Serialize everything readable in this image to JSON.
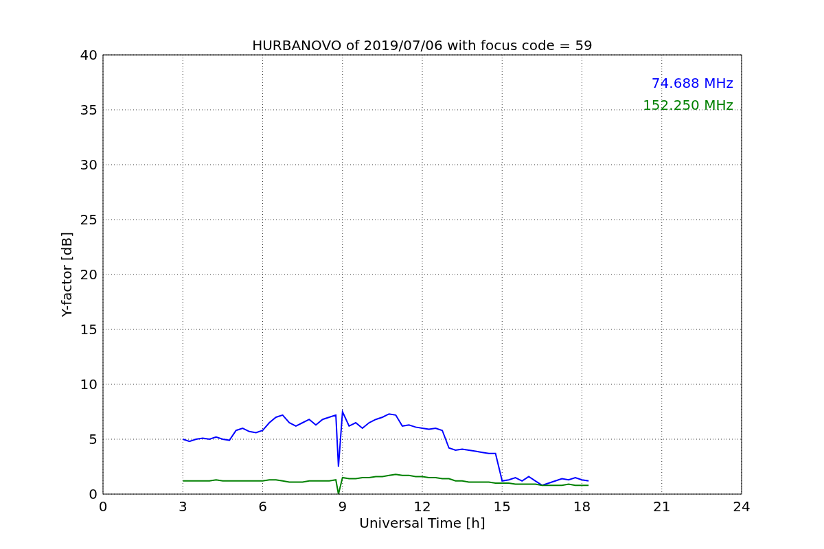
{
  "chart_data": {
    "type": "line",
    "title": "HURBANOVO of 2019/07/06 with focus code = 59",
    "xlabel": "Universal Time [h]",
    "ylabel": "Y-factor [dB]",
    "x": [
      3,
      3.25,
      3.5,
      3.75,
      4,
      4.25,
      4.5,
      4.75,
      5,
      5.25,
      5.5,
      5.75,
      6,
      6.25,
      6.5,
      6.75,
      7,
      7.25,
      7.5,
      7.75,
      8,
      8.25,
      8.5,
      8.75,
      8.85,
      9,
      9.25,
      9.5,
      9.75,
      10,
      10.25,
      10.5,
      10.75,
      11,
      11.25,
      11.5,
      11.75,
      12,
      12.25,
      12.5,
      12.75,
      13,
      13.25,
      13.5,
      13.75,
      14,
      14.25,
      14.5,
      14.75,
      15,
      15.25,
      15.5,
      15.75,
      16,
      16.25,
      16.5,
      16.75,
      17,
      17.25,
      17.5,
      17.75,
      18,
      18.25
    ],
    "series": [
      {
        "name": "74.688 MHz",
        "color": "#0000ff",
        "values": [
          5,
          4.8,
          5,
          5.1,
          5,
          5.2,
          5,
          4.9,
          5.8,
          6,
          5.7,
          5.6,
          5.8,
          6.5,
          7,
          7.2,
          6.5,
          6.2,
          6.5,
          6.8,
          6.3,
          6.8,
          7,
          7.2,
          2.5,
          7.5,
          6.2,
          6.5,
          6,
          6.5,
          6.8,
          7,
          7.3,
          7.2,
          6.2,
          6.3,
          6.1,
          6,
          5.9,
          6,
          5.8,
          4.2,
          4,
          4.1,
          4,
          3.9,
          3.8,
          3.7,
          3.7,
          1.2,
          1.3,
          1.5,
          1.2,
          1.6,
          1.2,
          0.8,
          1,
          1.2,
          1.4,
          1.3,
          1.5,
          1.3,
          1.2
        ]
      },
      {
        "name": "152.250 MHz",
        "color": "#008000",
        "values": [
          1.2,
          1.2,
          1.2,
          1.2,
          1.2,
          1.3,
          1.2,
          1.2,
          1.2,
          1.2,
          1.2,
          1.2,
          1.2,
          1.3,
          1.3,
          1.2,
          1.1,
          1.1,
          1.1,
          1.2,
          1.2,
          1.2,
          1.2,
          1.3,
          0,
          1.5,
          1.4,
          1.4,
          1.5,
          1.5,
          1.6,
          1.6,
          1.7,
          1.8,
          1.7,
          1.7,
          1.6,
          1.6,
          1.5,
          1.5,
          1.4,
          1.4,
          1.2,
          1.2,
          1.1,
          1.1,
          1.1,
          1.1,
          1,
          1,
          1,
          0.9,
          0.9,
          0.9,
          0.9,
          0.8,
          0.8,
          0.8,
          0.8,
          0.9,
          0.8,
          0.8,
          0.8
        ]
      }
    ],
    "grid": true,
    "xlim": [
      0,
      24
    ],
    "ylim": [
      0,
      40
    ],
    "xticks": [
      0,
      3,
      6,
      9,
      12,
      15,
      18,
      21,
      24
    ],
    "yticks": [
      0,
      5,
      10,
      15,
      20,
      25,
      30,
      35,
      40
    ]
  }
}
